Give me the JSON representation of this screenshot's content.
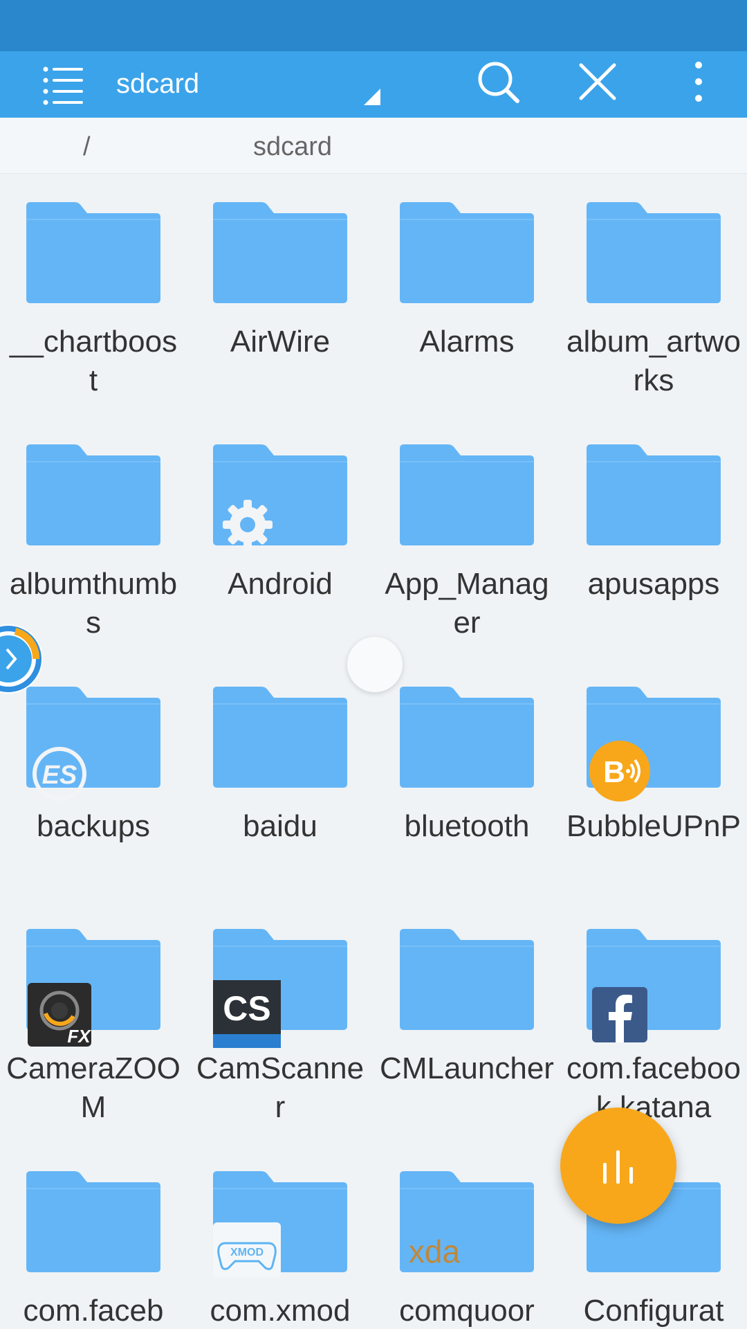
{
  "app_bar": {
    "title": "sdcard",
    "icons": [
      "menu-list-icon",
      "dropdown-triangle-icon",
      "search-icon",
      "close-icon",
      "more-vert-icon"
    ]
  },
  "breadcrumb": {
    "items": [
      "/",
      "sdcard"
    ]
  },
  "folders": [
    {
      "name": "__chartboost"
    },
    {
      "name": "AirWire"
    },
    {
      "name": "Alarms"
    },
    {
      "name": "album_artworks"
    },
    {
      "name": "albumthumbs"
    },
    {
      "name": "Android",
      "overlay": "gear-icon"
    },
    {
      "name": "App_Manager"
    },
    {
      "name": "apusapps"
    },
    {
      "name": "backups",
      "overlay": "es-logo-icon"
    },
    {
      "name": "baidu"
    },
    {
      "name": "bluetooth"
    },
    {
      "name": "BubbleUPnP",
      "overlay": "bubbleupnp-icon"
    },
    {
      "name": "CameraZOOM",
      "overlay": "camerazoom-fx-icon"
    },
    {
      "name": "CamScanner",
      "overlay": "camscanner-cs-icon"
    },
    {
      "name": "CMLauncher"
    },
    {
      "name": "com.facebook.katana",
      "overlay": "facebook-icon"
    },
    {
      "name": "com.faceb"
    },
    {
      "name": "com.xmod",
      "overlay": "xmod-icon"
    },
    {
      "name": "comquoor",
      "overlay": "xda-icon"
    },
    {
      "name": "Configurat"
    }
  ],
  "overlay_labels": {
    "cs": "CS",
    "fx": "FX",
    "xmod": "XMOD",
    "xda": "xda",
    "es": "ES",
    "bubble": "B"
  },
  "fab": {
    "icon": "analyze-bars-icon"
  },
  "floating_handle": {
    "icon": "chevron-right-icon"
  },
  "colors": {
    "status_bar": "#2a87cc",
    "app_bar": "#3ba3ea",
    "folder": "#64b5f6",
    "background": "#eff3f6",
    "fab": "#f8a71a"
  }
}
